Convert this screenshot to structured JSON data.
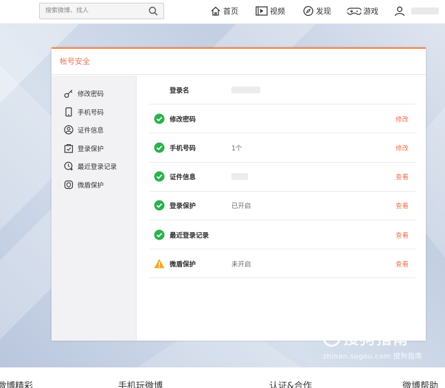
{
  "topbar": {
    "search_placeholder": "搜索微博、找人",
    "nav": [
      {
        "label": "首页",
        "icon": "home-icon"
      },
      {
        "label": "视频",
        "icon": "video-icon"
      },
      {
        "label": "发现",
        "icon": "compass-icon"
      },
      {
        "label": "游戏",
        "icon": "gamepad-icon"
      }
    ],
    "user_icon": "user-icon"
  },
  "card": {
    "title": "帐号安全",
    "accent": "#eb7350"
  },
  "sidebar": {
    "items": [
      {
        "label": "修改密码",
        "icon": "key-icon"
      },
      {
        "label": "手机号码",
        "icon": "phone-icon"
      },
      {
        "label": "证件信息",
        "icon": "id-card-icon"
      },
      {
        "label": "登录保护",
        "icon": "login-protect-icon"
      },
      {
        "label": "最近登录记录",
        "icon": "history-icon"
      },
      {
        "label": "微盾保护",
        "icon": "shield-icon"
      }
    ]
  },
  "main": {
    "login_name_label": "登录名",
    "rows": [
      {
        "label": "修改密码",
        "value": "",
        "action": "修改",
        "status": "ok"
      },
      {
        "label": "手机号码",
        "value": "1个",
        "action": "修改",
        "status": "ok"
      },
      {
        "label": "证件信息",
        "value": "",
        "action": "查看",
        "status": "ok"
      },
      {
        "label": "登录保护",
        "value": "已开启",
        "action": "查看",
        "status": "ok"
      },
      {
        "label": "最近登录记录",
        "value": "",
        "action": "查看",
        "status": "ok"
      },
      {
        "label": "微盾保护",
        "value": "未开启",
        "action": "查看",
        "status": "warn"
      }
    ]
  },
  "footer": {
    "links": [
      "微博精彩",
      "手机玩微博",
      "认证&合作",
      "微博帮助"
    ]
  },
  "watermark": {
    "title": "搜狗指南",
    "url": "zhinan.sogou.com",
    "sub": "搜狗指南"
  },
  "colors": {
    "ok": "#2bb24c",
    "warn": "#f5a623"
  }
}
